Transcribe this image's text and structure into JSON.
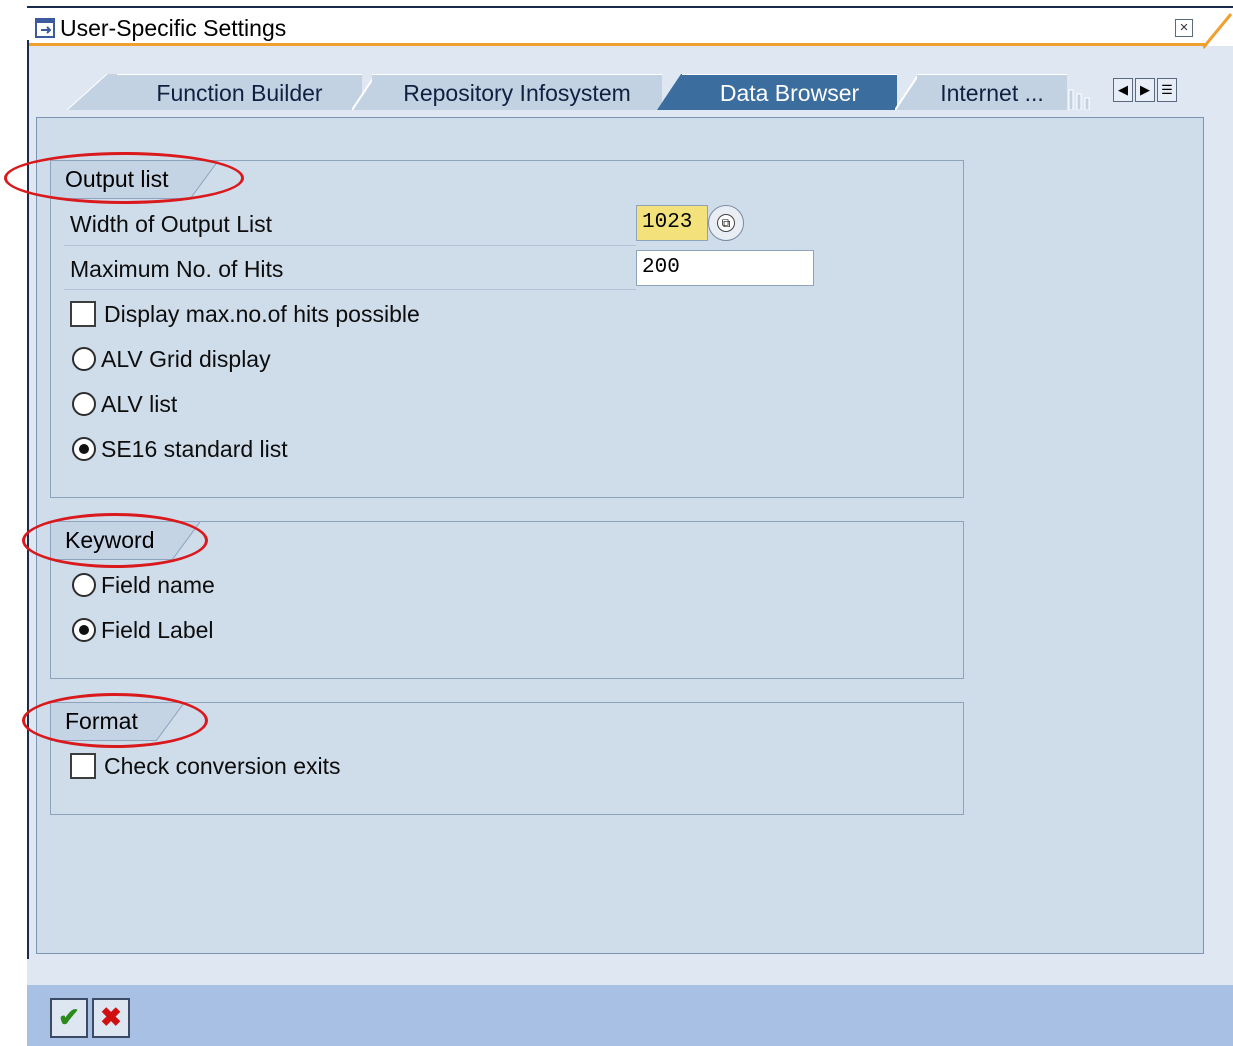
{
  "window": {
    "title": "User-Specific Settings",
    "close_icon": "close-icon"
  },
  "tabs": [
    {
      "label": "Function Builder",
      "active": false
    },
    {
      "label": "Repository Infosystem",
      "active": false
    },
    {
      "label": "Data Browser",
      "active": true
    },
    {
      "label": "Internet ...",
      "active": false
    }
  ],
  "tab_nav": {
    "prev_icon": "arrow-left-icon",
    "next_icon": "arrow-right-icon",
    "list_icon": "tab-list-icon"
  },
  "output_list": {
    "title": "Output list",
    "width_label": "Width of Output List",
    "width_value": "1023",
    "max_hits_label": "Maximum No. of Hits",
    "max_hits_value": "200",
    "display_max_label": "Display max.no.of hits possible",
    "display_max_checked": false,
    "alv_grid_label": "ALV Grid display",
    "alv_list_label": "ALV list",
    "se16_label": "SE16 standard list",
    "selected": "se16"
  },
  "keyword": {
    "title": "Keyword",
    "field_name_label": "Field name",
    "field_label_label": "Field Label",
    "selected": "field_label"
  },
  "format": {
    "title": "Format",
    "conversion_label": "Check conversion exits",
    "conversion_checked": false
  },
  "footer": {
    "confirm_icon": "checkmark-icon",
    "cancel_icon": "cancel-x-icon"
  },
  "colors": {
    "accent": "#3b6e9e",
    "highlight_ellipse": "#d9191c",
    "focused_field": "#f3e27c"
  }
}
